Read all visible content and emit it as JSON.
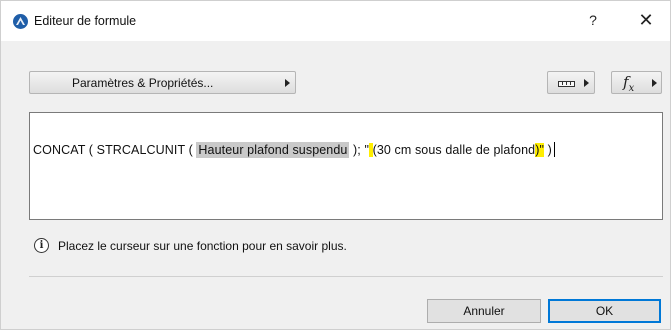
{
  "window": {
    "title": "Editeur de formule",
    "help_label": "?",
    "close_label": "✕"
  },
  "toolbar": {
    "params_label": "Paramètres & Propriétés...",
    "fx_label": "f",
    "fx_sub": "x"
  },
  "editor": {
    "before_param": "CONCAT ( STRCALCUNIT ( ",
    "param": "Hauteur plafond suspendu",
    "after_param": " ); \"",
    "hl1": " ",
    "middle1": " (",
    "middle2": "30 cm sous dalle de plafond",
    "hl2": ")\"",
    "end": " )"
  },
  "info": {
    "icon": "i",
    "text": "Placez le curseur sur une fonction pour en savoir plus."
  },
  "buttons": {
    "cancel_label": "Annuler",
    "ok_label": "OK"
  },
  "colors": {
    "accent": "#0078d7",
    "highlight": "#ffee00",
    "param_bg": "#c9c9c9"
  }
}
